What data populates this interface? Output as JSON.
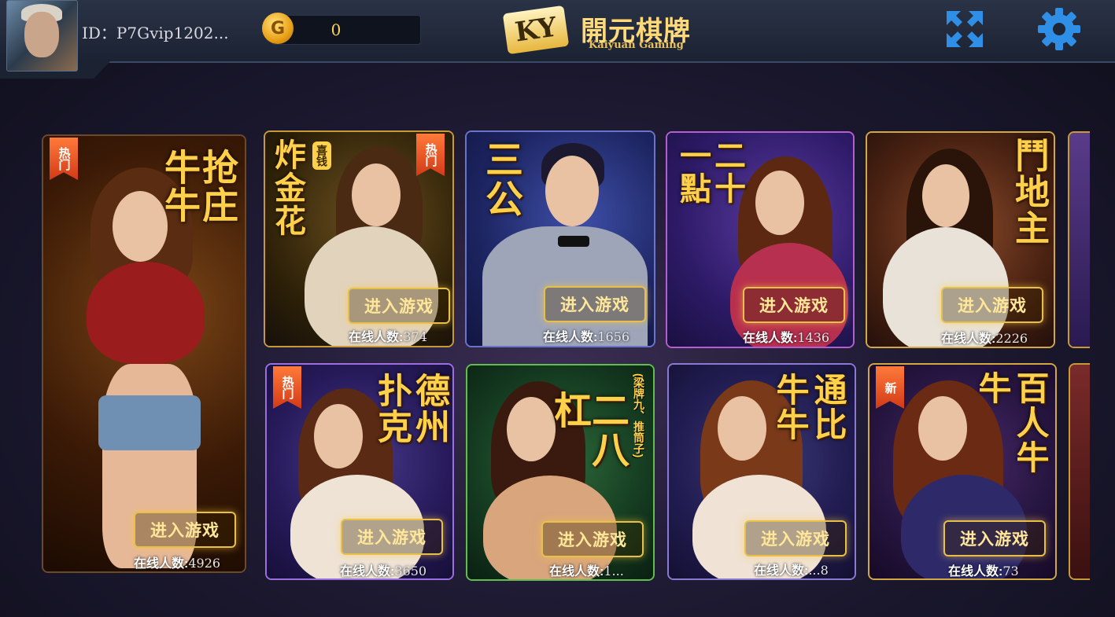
{
  "header": {
    "user_id": "ID：P7Gvip1202...",
    "coin_symbol": "G",
    "coin_balance": "0",
    "logo_badge": "KY",
    "logo_cn": "開元棋牌",
    "logo_en": "Kaiyuan Gaming",
    "fullscreen_icon": "expand-arrows-icon",
    "settings_icon": "gear-icon"
  },
  "games": [
    {
      "title": "抢庄牛牛",
      "tag": "热门",
      "enter": "进入游戏",
      "online_label": "在线人数:",
      "online_count": "4926"
    },
    {
      "title": "炸金花",
      "badge": "喜钱",
      "tag": "热门",
      "enter": "进入游戏",
      "online_label": "在线人数:",
      "online_count": "374"
    },
    {
      "title": "三公",
      "enter": "进入游戏",
      "online_label": "在线人数:",
      "online_count": "1656"
    },
    {
      "title": "二十一點",
      "enter": "进入游戏",
      "online_label": "在线人数:",
      "online_count": "1436"
    },
    {
      "title": "鬥地主",
      "enter": "进入游戏",
      "online_label": "在线人数:",
      "online_count": "2226"
    },
    {
      "title": "德州扑克",
      "tag": "热门",
      "enter": "进入游戏",
      "online_label": "在线人数:",
      "online_count": "3650"
    },
    {
      "title": "二八杠",
      "subtitle": "(梁牌九、推筒子)",
      "enter": "进入游戏",
      "online_label": "在线人数:",
      "online_count": "1..."
    },
    {
      "title": "通比牛牛",
      "enter": "进入游戏",
      "online_label": "在线人数:",
      "online_count": "...8"
    },
    {
      "title": "百人牛牛",
      "tag": "新",
      "enter": "进入游戏",
      "online_label": "在线人数:",
      "online_count": "73"
    }
  ]
}
